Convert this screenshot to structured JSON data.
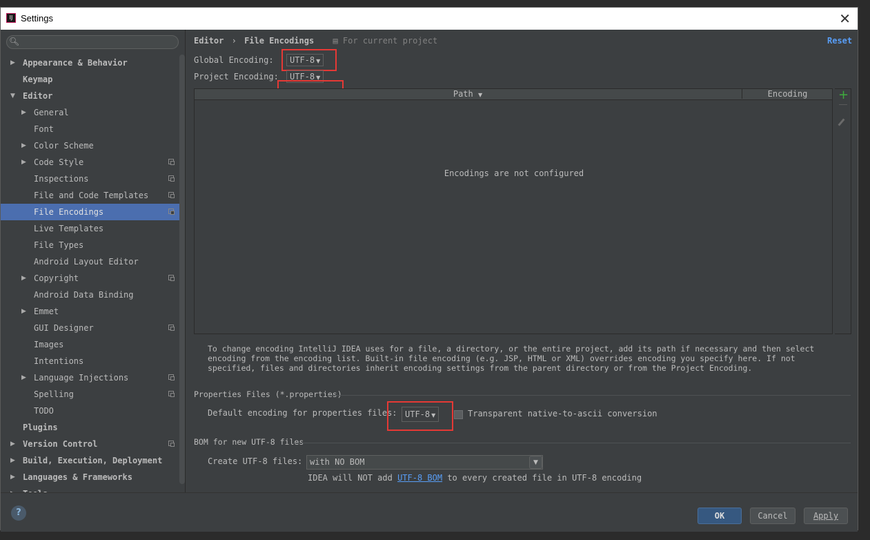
{
  "window": {
    "title": "Settings",
    "app_icon": "intellij-icon"
  },
  "sidebar": {
    "search_placeholder": "",
    "items": [
      {
        "label": "Appearance & Behavior",
        "level": 0,
        "arrow": "▶",
        "bold": true,
        "copy": false
      },
      {
        "label": "Keymap",
        "level": 0,
        "arrow": "",
        "bold": true,
        "copy": false
      },
      {
        "label": "Editor",
        "level": 0,
        "arrow": "▼",
        "bold": true,
        "copy": false
      },
      {
        "label": "General",
        "level": 1,
        "arrow": "▶",
        "bold": false,
        "copy": false
      },
      {
        "label": "Font",
        "level": 1,
        "arrow": "",
        "bold": false,
        "copy": false
      },
      {
        "label": "Color Scheme",
        "level": 1,
        "arrow": "▶",
        "bold": false,
        "copy": false
      },
      {
        "label": "Code Style",
        "level": 1,
        "arrow": "▶",
        "bold": false,
        "copy": true
      },
      {
        "label": "Inspections",
        "level": 1,
        "arrow": "",
        "bold": false,
        "copy": true
      },
      {
        "label": "File and Code Templates",
        "level": 1,
        "arrow": "",
        "bold": false,
        "copy": true
      },
      {
        "label": "File Encodings",
        "level": 1,
        "arrow": "",
        "bold": false,
        "copy": true,
        "selected": true
      },
      {
        "label": "Live Templates",
        "level": 1,
        "arrow": "",
        "bold": false,
        "copy": false
      },
      {
        "label": "File Types",
        "level": 1,
        "arrow": "",
        "bold": false,
        "copy": false
      },
      {
        "label": "Android Layout Editor",
        "level": 1,
        "arrow": "",
        "bold": false,
        "copy": false
      },
      {
        "label": "Copyright",
        "level": 1,
        "arrow": "▶",
        "bold": false,
        "copy": true
      },
      {
        "label": "Android Data Binding",
        "level": 1,
        "arrow": "",
        "bold": false,
        "copy": false
      },
      {
        "label": "Emmet",
        "level": 1,
        "arrow": "▶",
        "bold": false,
        "copy": false
      },
      {
        "label": "GUI Designer",
        "level": 1,
        "arrow": "",
        "bold": false,
        "copy": true
      },
      {
        "label": "Images",
        "level": 1,
        "arrow": "",
        "bold": false,
        "copy": false
      },
      {
        "label": "Intentions",
        "level": 1,
        "arrow": "",
        "bold": false,
        "copy": false
      },
      {
        "label": "Language Injections",
        "level": 1,
        "arrow": "▶",
        "bold": false,
        "copy": true
      },
      {
        "label": "Spelling",
        "level": 1,
        "arrow": "",
        "bold": false,
        "copy": true
      },
      {
        "label": "TODO",
        "level": 1,
        "arrow": "",
        "bold": false,
        "copy": false
      },
      {
        "label": "Plugins",
        "level": 0,
        "arrow": "",
        "bold": true,
        "copy": false
      },
      {
        "label": "Version Control",
        "level": 0,
        "arrow": "▶",
        "bold": true,
        "copy": true
      },
      {
        "label": "Build, Execution, Deployment",
        "level": 0,
        "arrow": "▶",
        "bold": true,
        "copy": false
      },
      {
        "label": "Languages & Frameworks",
        "level": 0,
        "arrow": "▶",
        "bold": true,
        "copy": false
      },
      {
        "label": "Tools",
        "level": 0,
        "arrow": "▶",
        "bold": true,
        "copy": false
      }
    ]
  },
  "breadcrumb": {
    "parent": "Editor",
    "sep": "›",
    "current": "File Encodings",
    "scope": "For current project"
  },
  "reset_label": "Reset",
  "global_encoding": {
    "label": "Global Encoding:",
    "value": "UTF-8"
  },
  "project_encoding": {
    "label": "Project Encoding:",
    "value": "UTF-8"
  },
  "table": {
    "col_path": "Path",
    "col_encoding": "Encoding",
    "empty_text": "Encodings are not configured"
  },
  "help_text": "To change encoding IntelliJ IDEA uses for a file, a directory, or the entire project, add its path if necessary and then select encoding from the encoding list. Built-in file encoding (e.g. JSP, HTML or XML) overrides encoding you specify here. If not specified, files and directories inherit encoding settings from the parent directory or from the Project Encoding.",
  "properties": {
    "section": "Properties Files (*.properties)",
    "default_label": "Default encoding for properties files:",
    "value": "UTF-8",
    "native_label": "Transparent native-to-ascii conversion"
  },
  "bom": {
    "section": "BOM for new UTF-8 files",
    "create_label": "Create UTF-8 files:",
    "value": "with NO BOM",
    "note_pre": "IDEA will NOT add",
    "note_link": "UTF-8 BOM",
    "note_post": "to every created file in UTF-8 encoding"
  },
  "footer": {
    "help": "?",
    "ok": "OK",
    "cancel": "Cancel",
    "apply": "Apply"
  },
  "colors": {
    "accent": "#4b6eaf",
    "link": "#589df6",
    "highlight": "#e53935",
    "add": "#3eac3e"
  }
}
